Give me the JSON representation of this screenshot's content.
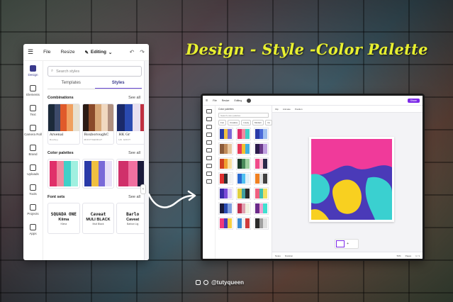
{
  "title": "Design - Style -Color Palette",
  "left_panel": {
    "topbar": {
      "file": "File",
      "resize": "Resize",
      "editing": "Editing"
    },
    "rail": [
      {
        "label": "Design",
        "icon": "design-icon"
      },
      {
        "label": "Elements",
        "icon": "elements-icon"
      },
      {
        "label": "Text",
        "icon": "text-icon"
      },
      {
        "label": "Camera Roll",
        "icon": "camera-icon"
      },
      {
        "label": "Brand",
        "icon": "brand-icon"
      },
      {
        "label": "Uploads",
        "icon": "uploads-icon"
      },
      {
        "label": "Tools",
        "icon": "tools-icon"
      },
      {
        "label": "Projects",
        "icon": "projects-icon"
      },
      {
        "label": "Apps",
        "icon": "apps-icon"
      }
    ],
    "search_placeholder": "Search styles",
    "tabs": [
      "Templates",
      "Styles"
    ],
    "combinations": {
      "heading": "Combinations",
      "see_all": "See all",
      "cards": [
        {
          "name": "Arsenal",
          "sub": "Radley",
          "colors": [
            "#1c2a3a",
            "#3d4a6a",
            "#e05a2a",
            "#f0a060",
            "#e8e0d0"
          ]
        },
        {
          "name": "RoxboroughC",
          "sub": "MONTSERRAT",
          "colors": [
            "#2a1a14",
            "#8a4a2a",
            "#d8a878",
            "#f0d8c0",
            "#b09080"
          ]
        },
        {
          "name": "HK Gr",
          "sub": "HK GROT",
          "colors": [
            "#1a2a6a",
            "#2a4ab0",
            "#e8e0f0",
            "#c03040"
          ]
        }
      ]
    },
    "color_palettes": {
      "heading": "Color palettes",
      "see_all": "See all",
      "palettes": [
        [
          "#e0306a",
          "#f08aa0",
          "#40d0c8",
          "#a0f0e0"
        ],
        [
          "#2a3aa8",
          "#f0c040",
          "#7a6ad8",
          "#e8e0f8"
        ],
        [
          "#d0306a",
          "#f070a0",
          "#1a1a3a"
        ]
      ]
    },
    "font_sets": {
      "heading": "Font sets",
      "see_all": "See all",
      "cards": [
        {
          "f1": "SQUADA ONE",
          "f2": "Kiima",
          "f3": "Kiima"
        },
        {
          "f1": "Caveat",
          "f2": "MULI BLACK",
          "f3": "Muli Black"
        },
        {
          "f1": "Barlo",
          "f2": "Caveat",
          "f3": "Barlow Lig"
        }
      ]
    }
  },
  "right_panel": {
    "side_heading": "Color palettes",
    "search_placeholder": "Search color palettes",
    "chips": [
      "Fun",
      "Creative",
      "Lively",
      "Modern",
      "Co"
    ],
    "palettes": [
      [
        "#2a3aa8",
        "#f0c040",
        "#7a6ad8"
      ],
      [
        "#e0306a",
        "#f08aa0",
        "#40d0c8"
      ],
      [
        "#2a3aa8",
        "#4a6ad8",
        "#a0c0f0"
      ],
      [
        "#8a5a3a",
        "#c08a5a",
        "#e8c8a0"
      ],
      [
        "#e83a5a",
        "#f0c030",
        "#40b0e0"
      ],
      [
        "#2a1a4a",
        "#6a3a8a",
        "#c0a0e0"
      ],
      [
        "#d04020",
        "#f0a030",
        "#f8e0a0"
      ],
      [
        "#1a3a2a",
        "#4a8a5a",
        "#a0d0a0"
      ],
      [
        "#f04a8a",
        "#f8c0d8",
        "#2a2a4a"
      ],
      [
        "#e03030",
        "#303030",
        "#f0f0f0"
      ],
      [
        "#2a6ad0",
        "#50c0f0",
        "#e0f0f8"
      ],
      [
        "#f08020",
        "#e0e0e0",
        "#404040"
      ],
      [
        "#3a2aa8",
        "#7a4ad8",
        "#e0d0f8"
      ],
      [
        "#e0d040",
        "#40a0a0",
        "#2a2a2a"
      ],
      [
        "#f06080",
        "#40c0b0",
        "#f0e060"
      ],
      [
        "#1a1a3a",
        "#2a4ab0",
        "#80a0e0"
      ],
      [
        "#c03050",
        "#e0a0b0",
        "#f0f0e0"
      ],
      [
        "#6a2a8a",
        "#f0a0d0",
        "#40e0d0"
      ],
      [
        "#f03a7a",
        "#4a3ab8",
        "#f8d040"
      ],
      [
        "#3a8ad0",
        "#f0f0f0",
        "#d03a3a"
      ],
      [
        "#2a2a2a",
        "#a0a0a0",
        "#e0e0e0"
      ]
    ],
    "footer": {
      "notes": "Notes",
      "duration": "Duration",
      "zoom": "53%",
      "pages": "Pages",
      "page_count": "1 / 1"
    },
    "toolbar": {
      "fill": "Flip",
      "animate": "Animate",
      "position": "Position"
    },
    "share": "Share",
    "artwork_colors": {
      "bg": "#4a3ab8",
      "pink": "#f03a9a",
      "teal": "#3ad0d0",
      "yellow": "#f8d020",
      "purple": "#3a2a98"
    }
  },
  "credit": {
    "handle": "@tutyqueen"
  }
}
